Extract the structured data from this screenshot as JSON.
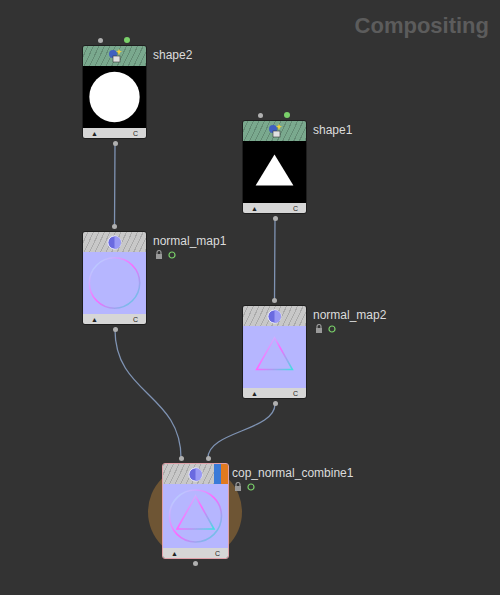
{
  "title": "Compositing",
  "nodes": [
    {
      "name": "shape2",
      "kind": "shape",
      "preview": "circle",
      "selected": false,
      "locked": false,
      "display": false,
      "footer_left": "▲",
      "footer_right": "C"
    },
    {
      "name": "shape1",
      "kind": "shape",
      "preview": "triangle",
      "selected": false,
      "locked": false,
      "display": false,
      "footer_left": "▲",
      "footer_right": "C"
    },
    {
      "name": "normal_map1",
      "kind": "filter",
      "preview": "circle",
      "selected": false,
      "locked": true,
      "display": false,
      "footer_left": "▲",
      "footer_right": "C"
    },
    {
      "name": "normal_map2",
      "kind": "filter",
      "preview": "triangle",
      "selected": false,
      "locked": true,
      "display": false,
      "footer_left": "▲",
      "footer_right": "C"
    },
    {
      "name": "cop_normal_combine1",
      "kind": "combine",
      "preview": "both",
      "selected": true,
      "locked": true,
      "display": true,
      "footer_left": "▲",
      "footer_right": "C"
    }
  ],
  "wires": [
    {
      "from": 0,
      "to": 2,
      "input": 0
    },
    {
      "from": 1,
      "to": 3,
      "input": 0
    },
    {
      "from": 2,
      "to": 4,
      "input": 0
    },
    {
      "from": 3,
      "to": 4,
      "input": 1
    }
  ]
}
